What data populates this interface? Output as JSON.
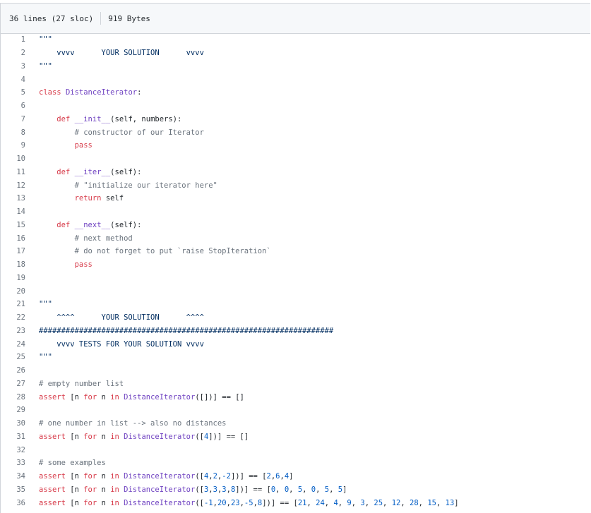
{
  "header": {
    "lines_info": "36 lines (27 sloc)",
    "size_info": "919 Bytes"
  },
  "code": {
    "lines": [
      [
        {
          "t": "\"\"\"",
          "c": "str"
        }
      ],
      [
        {
          "t": "    vvvv      YOUR SOLUTION      vvvv",
          "c": "str"
        }
      ],
      [
        {
          "t": "\"\"\"",
          "c": "str"
        }
      ],
      [],
      [
        {
          "t": "class ",
          "c": "kw"
        },
        {
          "t": "DistanceIterator",
          "c": "cls"
        },
        {
          "t": ":",
          "c": ""
        }
      ],
      [],
      [
        {
          "t": "    ",
          "c": ""
        },
        {
          "t": "def ",
          "c": "kw"
        },
        {
          "t": "__init__",
          "c": "fn"
        },
        {
          "t": "(self, numbers):",
          "c": ""
        }
      ],
      [
        {
          "t": "        # constructor of our Iterator",
          "c": "cm"
        }
      ],
      [
        {
          "t": "        ",
          "c": ""
        },
        {
          "t": "pass",
          "c": "kw"
        }
      ],
      [],
      [
        {
          "t": "    ",
          "c": ""
        },
        {
          "t": "def ",
          "c": "kw"
        },
        {
          "t": "__iter__",
          "c": "fn"
        },
        {
          "t": "(self):",
          "c": ""
        }
      ],
      [
        {
          "t": "        # \"initialize our iterator here\"",
          "c": "cm"
        }
      ],
      [
        {
          "t": "        ",
          "c": ""
        },
        {
          "t": "return ",
          "c": "kw"
        },
        {
          "t": "self",
          "c": ""
        }
      ],
      [],
      [
        {
          "t": "    ",
          "c": ""
        },
        {
          "t": "def ",
          "c": "kw"
        },
        {
          "t": "__next__",
          "c": "fn"
        },
        {
          "t": "(self):",
          "c": ""
        }
      ],
      [
        {
          "t": "        # next method",
          "c": "cm"
        }
      ],
      [
        {
          "t": "        # do not forget to put `raise StopIteration`",
          "c": "cm"
        }
      ],
      [
        {
          "t": "        ",
          "c": ""
        },
        {
          "t": "pass",
          "c": "kw"
        }
      ],
      [],
      [],
      [
        {
          "t": "\"\"\"",
          "c": "str"
        }
      ],
      [
        {
          "t": "    ^^^^      YOUR SOLUTION      ^^^^",
          "c": "str"
        }
      ],
      [
        {
          "t": "##################################################################",
          "c": "str"
        }
      ],
      [
        {
          "t": "    vvvv TESTS FOR YOUR SOLUTION vvvv",
          "c": "str"
        }
      ],
      [
        {
          "t": "\"\"\"",
          "c": "str"
        }
      ],
      [],
      [
        {
          "t": "# empty number list",
          "c": "cm"
        }
      ],
      [
        {
          "t": "assert ",
          "c": "kw"
        },
        {
          "t": "[n ",
          "c": ""
        },
        {
          "t": "for ",
          "c": "kw"
        },
        {
          "t": "n ",
          "c": ""
        },
        {
          "t": "in ",
          "c": "kw"
        },
        {
          "t": "DistanceIterator",
          "c": "cls"
        },
        {
          "t": "([])] == []",
          "c": ""
        }
      ],
      [],
      [
        {
          "t": "# one number in list --> also no distances",
          "c": "cm"
        }
      ],
      [
        {
          "t": "assert ",
          "c": "kw"
        },
        {
          "t": "[n ",
          "c": ""
        },
        {
          "t": "for ",
          "c": "kw"
        },
        {
          "t": "n ",
          "c": ""
        },
        {
          "t": "in ",
          "c": "kw"
        },
        {
          "t": "DistanceIterator",
          "c": "cls"
        },
        {
          "t": "([",
          "c": ""
        },
        {
          "t": "4",
          "c": "num"
        },
        {
          "t": "])] == []",
          "c": ""
        }
      ],
      [],
      [
        {
          "t": "# some examples",
          "c": "cm"
        }
      ],
      [
        {
          "t": "assert ",
          "c": "kw"
        },
        {
          "t": "[n ",
          "c": ""
        },
        {
          "t": "for ",
          "c": "kw"
        },
        {
          "t": "n ",
          "c": ""
        },
        {
          "t": "in ",
          "c": "kw"
        },
        {
          "t": "DistanceIterator",
          "c": "cls"
        },
        {
          "t": "([",
          "c": ""
        },
        {
          "t": "4",
          "c": "num"
        },
        {
          "t": ",",
          "c": ""
        },
        {
          "t": "2",
          "c": "num"
        },
        {
          "t": ",",
          "c": ""
        },
        {
          "t": "-2",
          "c": "num"
        },
        {
          "t": "])] == [",
          "c": ""
        },
        {
          "t": "2",
          "c": "num"
        },
        {
          "t": ",",
          "c": ""
        },
        {
          "t": "6",
          "c": "num"
        },
        {
          "t": ",",
          "c": ""
        },
        {
          "t": "4",
          "c": "num"
        },
        {
          "t": "]",
          "c": ""
        }
      ],
      [
        {
          "t": "assert ",
          "c": "kw"
        },
        {
          "t": "[n ",
          "c": ""
        },
        {
          "t": "for ",
          "c": "kw"
        },
        {
          "t": "n ",
          "c": ""
        },
        {
          "t": "in ",
          "c": "kw"
        },
        {
          "t": "DistanceIterator",
          "c": "cls"
        },
        {
          "t": "([",
          "c": ""
        },
        {
          "t": "3",
          "c": "num"
        },
        {
          "t": ",",
          "c": ""
        },
        {
          "t": "3",
          "c": "num"
        },
        {
          "t": ",",
          "c": ""
        },
        {
          "t": "3",
          "c": "num"
        },
        {
          "t": ",",
          "c": ""
        },
        {
          "t": "8",
          "c": "num"
        },
        {
          "t": "])] == [",
          "c": ""
        },
        {
          "t": "0",
          "c": "num"
        },
        {
          "t": ", ",
          "c": ""
        },
        {
          "t": "0",
          "c": "num"
        },
        {
          "t": ", ",
          "c": ""
        },
        {
          "t": "5",
          "c": "num"
        },
        {
          "t": ", ",
          "c": ""
        },
        {
          "t": "0",
          "c": "num"
        },
        {
          "t": ", ",
          "c": ""
        },
        {
          "t": "5",
          "c": "num"
        },
        {
          "t": ", ",
          "c": ""
        },
        {
          "t": "5",
          "c": "num"
        },
        {
          "t": "]",
          "c": ""
        }
      ],
      [
        {
          "t": "assert ",
          "c": "kw"
        },
        {
          "t": "[n ",
          "c": ""
        },
        {
          "t": "for ",
          "c": "kw"
        },
        {
          "t": "n ",
          "c": ""
        },
        {
          "t": "in ",
          "c": "kw"
        },
        {
          "t": "DistanceIterator",
          "c": "cls"
        },
        {
          "t": "([",
          "c": ""
        },
        {
          "t": "-1",
          "c": "num"
        },
        {
          "t": ",",
          "c": ""
        },
        {
          "t": "20",
          "c": "num"
        },
        {
          "t": ",",
          "c": ""
        },
        {
          "t": "23",
          "c": "num"
        },
        {
          "t": ",",
          "c": ""
        },
        {
          "t": "-5",
          "c": "num"
        },
        {
          "t": ",",
          "c": ""
        },
        {
          "t": "8",
          "c": "num"
        },
        {
          "t": "])] == [",
          "c": ""
        },
        {
          "t": "21",
          "c": "num"
        },
        {
          "t": ", ",
          "c": ""
        },
        {
          "t": "24",
          "c": "num"
        },
        {
          "t": ", ",
          "c": ""
        },
        {
          "t": "4",
          "c": "num"
        },
        {
          "t": ", ",
          "c": ""
        },
        {
          "t": "9",
          "c": "num"
        },
        {
          "t": ", ",
          "c": ""
        },
        {
          "t": "3",
          "c": "num"
        },
        {
          "t": ", ",
          "c": ""
        },
        {
          "t": "25",
          "c": "num"
        },
        {
          "t": ", ",
          "c": ""
        },
        {
          "t": "12",
          "c": "num"
        },
        {
          "t": ", ",
          "c": ""
        },
        {
          "t": "28",
          "c": "num"
        },
        {
          "t": ", ",
          "c": ""
        },
        {
          "t": "15",
          "c": "num"
        },
        {
          "t": ", ",
          "c": ""
        },
        {
          "t": "13",
          "c": "num"
        },
        {
          "t": "]",
          "c": ""
        }
      ]
    ]
  }
}
